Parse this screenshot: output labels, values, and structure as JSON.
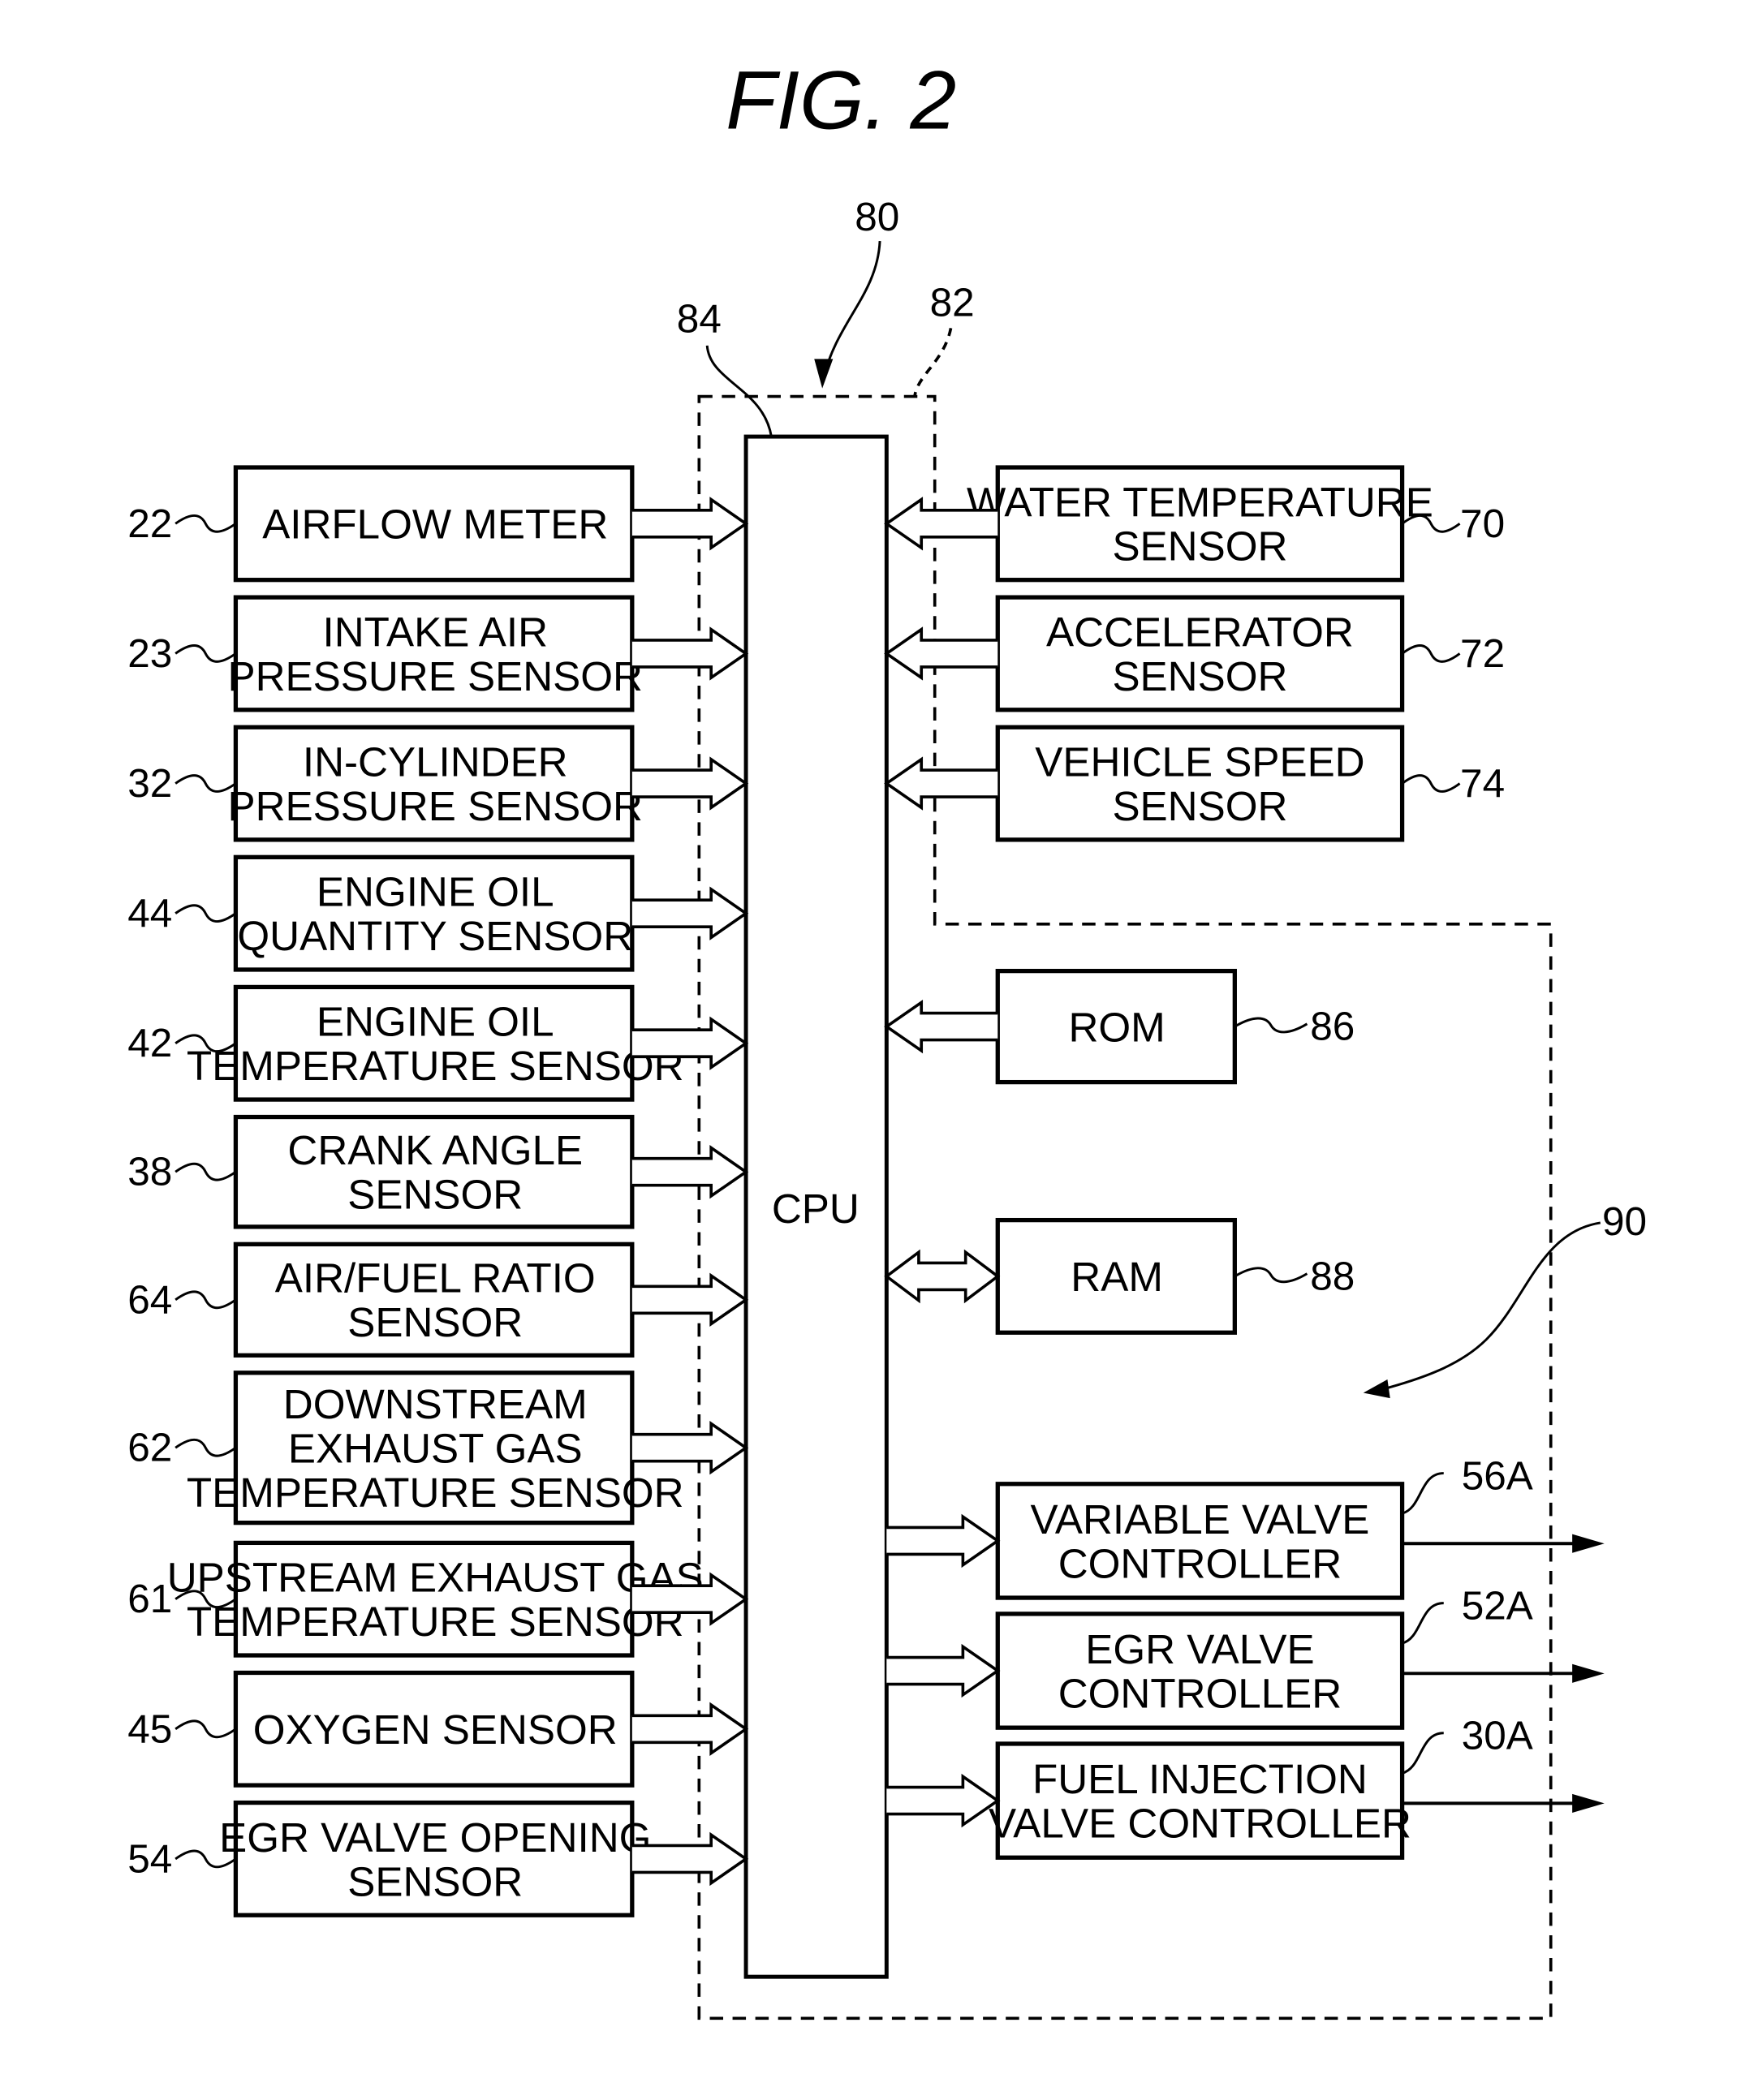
{
  "figure": {
    "title": "FIG.  2",
    "ecu_ref": "80",
    "io_boundary_ref": "82",
    "cpu_ref": "84",
    "output_region_ref": "90",
    "cpu_label": "CPU"
  },
  "input_sensors_left": [
    {
      "ref": "22",
      "lines": [
        "AIRFLOW METER"
      ]
    },
    {
      "ref": "23",
      "lines": [
        "INTAKE AIR",
        "PRESSURE SENSOR"
      ]
    },
    {
      "ref": "32",
      "lines": [
        "IN-CYLINDER",
        "PRESSURE SENSOR"
      ]
    },
    {
      "ref": "44",
      "lines": [
        "ENGINE OIL",
        "QUANTITY SENSOR"
      ]
    },
    {
      "ref": "42",
      "lines": [
        "ENGINE OIL",
        "TEMPERATURE SENSOR"
      ]
    },
    {
      "ref": "38",
      "lines": [
        "CRANK ANGLE",
        "SENSOR"
      ]
    },
    {
      "ref": "64",
      "lines": [
        "AIR/FUEL RATIO",
        "SENSOR"
      ]
    },
    {
      "ref": "62",
      "lines": [
        "DOWNSTREAM",
        "EXHAUST GAS",
        "TEMPERATURE SENSOR"
      ]
    },
    {
      "ref": "61",
      "lines": [
        "UPSTREAM EXHAUST GAS",
        "TEMPERATURE SENSOR"
      ]
    },
    {
      "ref": "45",
      "lines": [
        "OXYGEN SENSOR"
      ]
    },
    {
      "ref": "54",
      "lines": [
        "EGR VALVE OPENING",
        "SENSOR"
      ]
    }
  ],
  "input_sensors_right": [
    {
      "ref": "70",
      "lines": [
        "WATER TEMPERATURE",
        "SENSOR"
      ]
    },
    {
      "ref": "72",
      "lines": [
        "ACCELERATOR",
        "SENSOR"
      ]
    },
    {
      "ref": "74",
      "lines": [
        "VEHICLE SPEED",
        "SENSOR"
      ]
    }
  ],
  "memory": [
    {
      "ref": "86",
      "lines": [
        "ROM"
      ],
      "direction": "to-cpu"
    },
    {
      "ref": "88",
      "lines": [
        "RAM"
      ],
      "direction": "bidirectional"
    }
  ],
  "output_controllers": [
    {
      "ref": "56A",
      "lines": [
        "VARIABLE VALVE",
        "CONTROLLER"
      ]
    },
    {
      "ref": "52A",
      "lines": [
        "EGR VALVE",
        "CONTROLLER"
      ]
    },
    {
      "ref": "30A",
      "lines": [
        "FUEL INJECTION",
        "VALVE CONTROLLER"
      ]
    }
  ]
}
